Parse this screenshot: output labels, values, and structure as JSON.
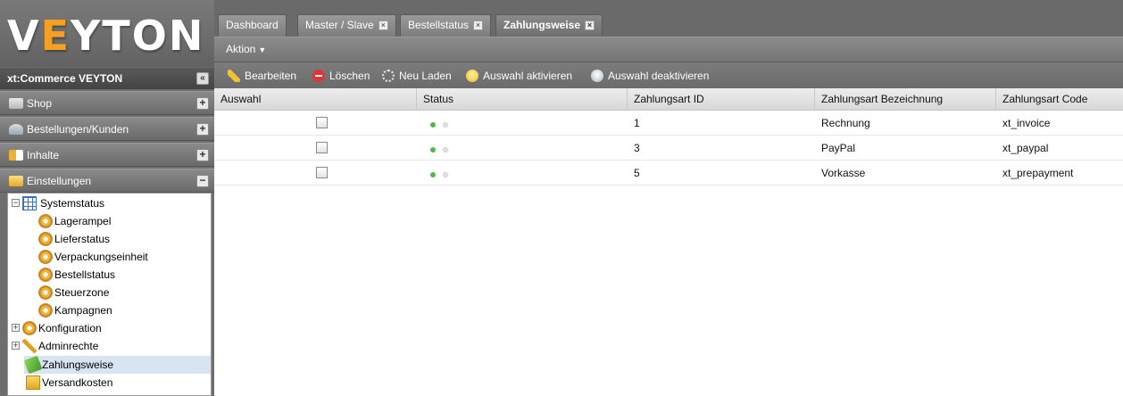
{
  "sidebar": {
    "logo": {
      "left": "V",
      "accent": "E",
      "right": "YTON"
    },
    "app_title": "xt:Commerce VEYTON",
    "accordion": [
      {
        "label": "Shop",
        "icon": "cart-icon",
        "toggle": "+"
      },
      {
        "label": "Bestellungen/Kunden",
        "icon": "customers-icon",
        "toggle": "+"
      },
      {
        "label": "Inhalte",
        "icon": "content-icon",
        "toggle": "+"
      },
      {
        "label": "Einstellungen",
        "icon": "settings-icon",
        "toggle": "−"
      }
    ],
    "tree": [
      {
        "label": "Systemstatus",
        "icon": "systemstatus-icon",
        "expander": "−"
      },
      {
        "label": "Lagerampel",
        "icon": "gear-icon"
      },
      {
        "label": "Lieferstatus",
        "icon": "gear-icon"
      },
      {
        "label": "Verpackungseinheit",
        "icon": "gear-icon"
      },
      {
        "label": "Bestellstatus",
        "icon": "gear-icon"
      },
      {
        "label": "Steuerzone",
        "icon": "gear-icon"
      },
      {
        "label": "Kampagnen",
        "icon": "gear-icon"
      },
      {
        "label": "Konfiguration",
        "icon": "gear-icon",
        "expander": "+"
      },
      {
        "label": "Adminrechte",
        "icon": "key-icon",
        "expander": "+"
      },
      {
        "label": "Zahlungsweise",
        "icon": "payment-icon",
        "selected": true
      },
      {
        "label": "Versandkosten",
        "icon": "box-icon"
      }
    ]
  },
  "tabs": [
    {
      "label": "Dashboard",
      "closable": false
    },
    {
      "label": "Master / Slave",
      "closable": true
    },
    {
      "label": "Bestellstatus",
      "closable": true
    },
    {
      "label": "Zahlungsweise",
      "closable": true,
      "active": true
    }
  ],
  "tab_close_glyph": "×",
  "actionbar": {
    "label": "Aktion",
    "arrow": "▼"
  },
  "toolbar": [
    {
      "label": "Bearbeiten",
      "icon": "pencil-icon"
    },
    {
      "label": "Löschen",
      "icon": "delete-icon"
    },
    {
      "label": "Neu Laden",
      "icon": "reload-icon"
    },
    {
      "label": "Auswahl aktivieren",
      "icon": "bulb-on-icon"
    },
    {
      "label": "Auswahl deaktivieren",
      "icon": "bulb-off-icon"
    }
  ],
  "grid": {
    "columns": [
      "Auswahl",
      "Status",
      "Zahlungsart ID",
      "Zahlungsart Bezeichnung",
      "Zahlungsart Code"
    ],
    "rows": [
      {
        "checked": false,
        "status": "active",
        "id": "1",
        "name": "Rechnung",
        "code": "xt_invoice"
      },
      {
        "checked": false,
        "status": "active",
        "id": "3",
        "name": "PayPal",
        "code": "xt_paypal"
      },
      {
        "checked": false,
        "status": "active",
        "id": "5",
        "name": "Vorkasse",
        "code": "xt_prepayment"
      }
    ]
  },
  "colors": {
    "sidebar_bg": "#6e6e6e",
    "logo_accent": "#f5a020",
    "status_active": "#53b84a",
    "status_inactive": "#e2e2e2",
    "tree_selected": "#d8e4f2"
  }
}
